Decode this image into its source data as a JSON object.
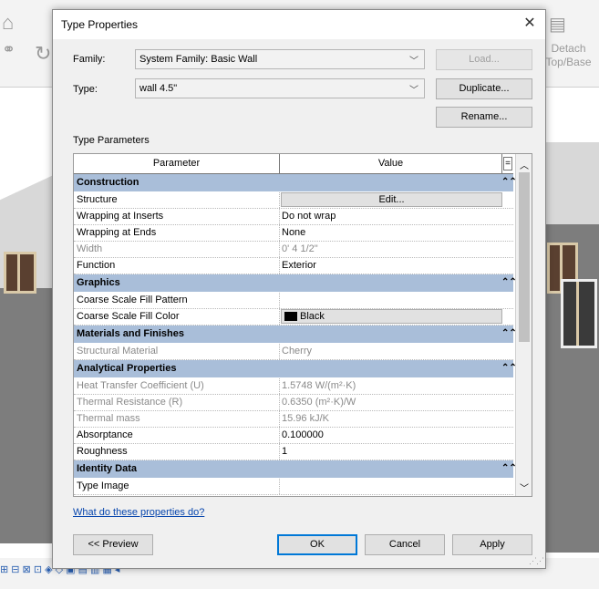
{
  "dialog": {
    "title": "Type Properties",
    "family_label": "Family:",
    "family_value": "System Family: Basic Wall",
    "type_label": "Type:",
    "type_value": "wall 4.5\"",
    "load_label": "Load...",
    "duplicate_label": "Duplicate...",
    "rename_label": "Rename...",
    "section_label": "Type Parameters",
    "col_parameter": "Parameter",
    "col_value": "Value",
    "eq_symbol": "=",
    "help_link": "What do these properties do?",
    "preview_label": "<< Preview",
    "ok_label": "OK",
    "cancel_label": "Cancel",
    "apply_label": "Apply"
  },
  "groups": {
    "construction": "Construction",
    "graphics": "Graphics",
    "materials": "Materials and Finishes",
    "analytical": "Analytical Properties",
    "identity": "Identity Data"
  },
  "rows": {
    "structure": {
      "param": "Structure",
      "value": "Edit..."
    },
    "wrap_inserts": {
      "param": "Wrapping at Inserts",
      "value": "Do not wrap"
    },
    "wrap_ends": {
      "param": "Wrapping at Ends",
      "value": "None"
    },
    "width": {
      "param": "Width",
      "value": "0'  4 1/2\""
    },
    "function": {
      "param": "Function",
      "value": "Exterior"
    },
    "fill_pattern": {
      "param": "Coarse Scale Fill Pattern",
      "value": ""
    },
    "fill_color": {
      "param": "Coarse Scale Fill Color",
      "value": "Black"
    },
    "struct_material": {
      "param": "Structural Material",
      "value": "Cherry"
    },
    "heat_transfer": {
      "param": "Heat Transfer Coefficient (U)",
      "value": "1.5748 W/(m²·K)"
    },
    "thermal_resistance": {
      "param": "Thermal Resistance (R)",
      "value": "0.6350 (m²·K)/W"
    },
    "thermal_mass": {
      "param": "Thermal mass",
      "value": "15.96 kJ/K"
    },
    "absorptance": {
      "param": "Absorptance",
      "value": "0.100000"
    },
    "roughness": {
      "param": "Roughness",
      "value": "1"
    },
    "type_image": {
      "param": "Type Image",
      "value": ""
    }
  },
  "background": {
    "detach_line1": "Detach",
    "detach_line2": "Top/Base"
  },
  "colors": {
    "group_header": "#a9bed9",
    "default_button_border": "#0078d7",
    "swatch": "#000000"
  }
}
